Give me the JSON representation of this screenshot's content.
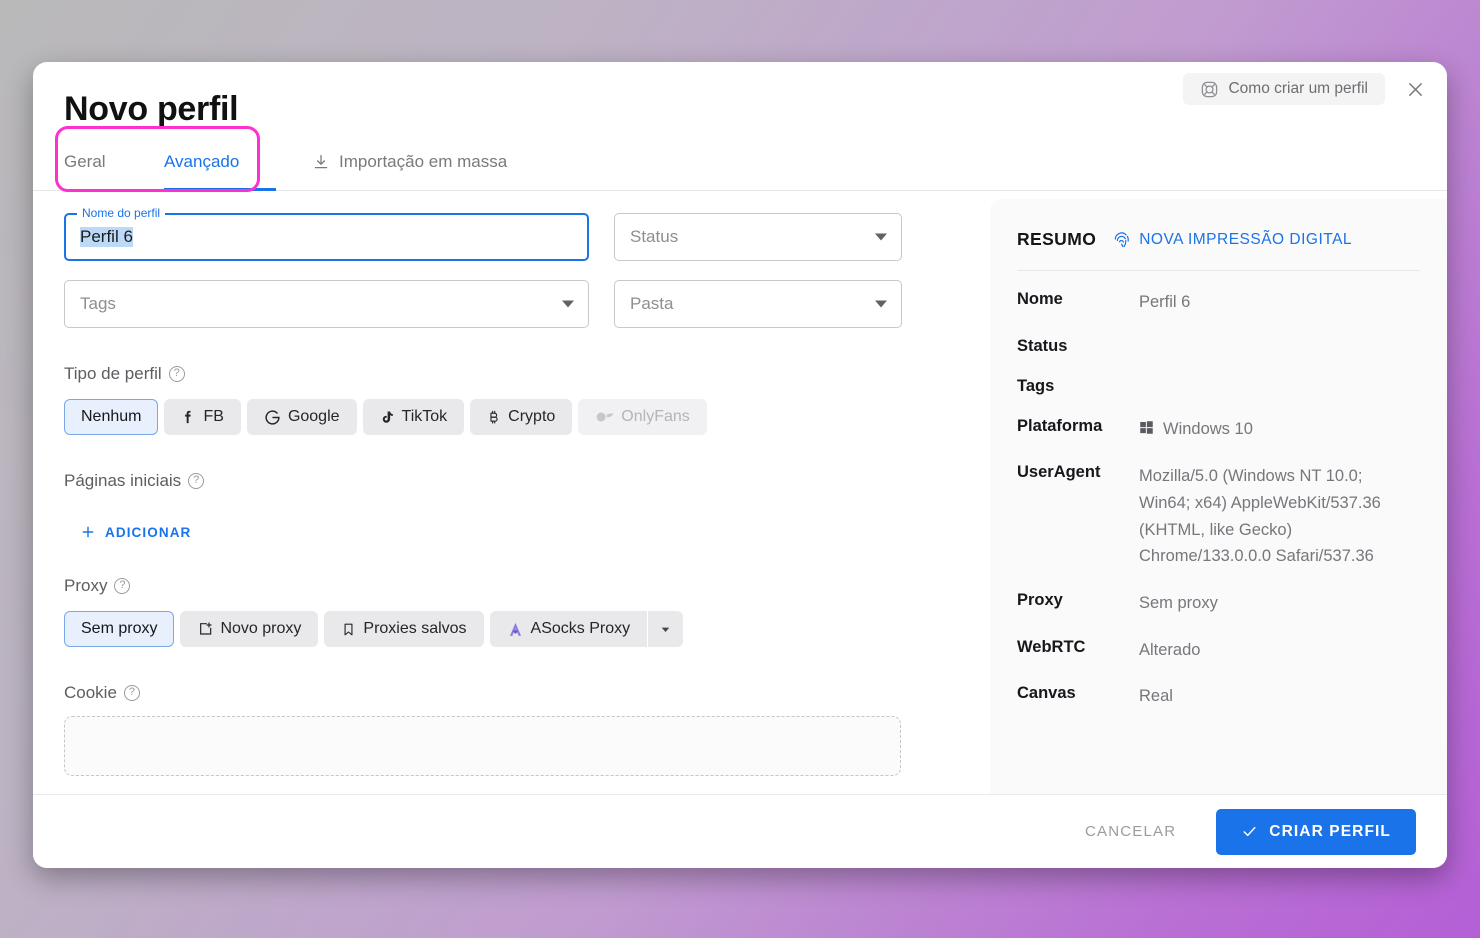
{
  "window": {
    "title": "Novo perfil",
    "help_button": "Como criar um perfil",
    "help_icon": "lifebuoy-icon",
    "close_icon": "close-icon"
  },
  "tabs": [
    {
      "label": "Geral",
      "active": false,
      "icon": null
    },
    {
      "label": "Avançado",
      "active": true,
      "icon": null
    },
    {
      "label": "Importação em massa",
      "active": false,
      "icon": "download-icon"
    }
  ],
  "highlight_color": "#ff2fd0",
  "accent_color": "#1a73e8",
  "form": {
    "profile_name": {
      "legend": "Nome do perfil",
      "value": "Perfil 6",
      "selected": true
    },
    "status": {
      "placeholder": "Status",
      "value": ""
    },
    "tags": {
      "placeholder": "Tags",
      "value": ""
    },
    "folder": {
      "placeholder": "Pasta",
      "value": ""
    },
    "profile_type": {
      "label": "Tipo de perfil",
      "options": [
        {
          "label": "Nenhum",
          "icon": null,
          "selected": true,
          "disabled": false
        },
        {
          "label": "FB",
          "icon": "facebook-icon",
          "selected": false,
          "disabled": false
        },
        {
          "label": "Google",
          "icon": "google-icon",
          "selected": false,
          "disabled": false
        },
        {
          "label": "TikTok",
          "icon": "tiktok-icon",
          "selected": false,
          "disabled": false
        },
        {
          "label": "Crypto",
          "icon": "bitcoin-icon",
          "selected": false,
          "disabled": false
        },
        {
          "label": "OnlyFans",
          "icon": "onlyfans-icon",
          "selected": false,
          "disabled": true
        }
      ]
    },
    "start_pages": {
      "label": "Páginas iniciais",
      "add_label": "ADICIONAR"
    },
    "proxy": {
      "label": "Proxy",
      "options": [
        {
          "label": "Sem proxy",
          "icon": null,
          "selected": true
        },
        {
          "label": "Novo proxy",
          "icon": "new-window-icon",
          "selected": false
        },
        {
          "label": "Proxies salvos",
          "icon": "bookmark-icon",
          "selected": false
        },
        {
          "label": "ASocks Proxy",
          "icon": "asocks-icon",
          "selected": false
        }
      ],
      "dropdown_icon": "chevron-down-icon"
    },
    "cookie": {
      "label": "Cookie"
    }
  },
  "summary": {
    "title": "RESUMO",
    "fingerprint_link": "NOVA IMPRESSÃO DIGITAL",
    "fingerprint_icon": "fingerprint-icon",
    "rows": [
      {
        "key": "Nome",
        "value": "Perfil 6",
        "icon": null
      },
      {
        "key": "Status",
        "value": "",
        "icon": null
      },
      {
        "key": "Tags",
        "value": "",
        "icon": null
      },
      {
        "key": "Plataforma",
        "value": "Windows 10",
        "icon": "windows-icon"
      },
      {
        "key": "UserAgent",
        "value": "Mozilla/5.0 (Windows NT 10.0; Win64; x64) AppleWebKit/537.36 (KHTML, like Gecko) Chrome/133.0.0.0 Safari/537.36",
        "icon": null
      },
      {
        "key": "Proxy",
        "value": "Sem proxy",
        "icon": null
      },
      {
        "key": "WebRTC",
        "value": "Alterado",
        "icon": null
      },
      {
        "key": "Canvas",
        "value": "Real",
        "icon": null
      }
    ]
  },
  "footer": {
    "cancel_label": "CANCELAR",
    "create_label": "CRIAR PERFIL",
    "create_icon": "check-icon"
  }
}
